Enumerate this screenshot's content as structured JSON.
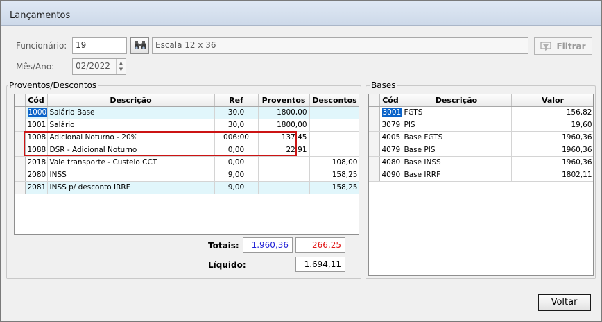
{
  "window": {
    "title": "Lançamentos"
  },
  "header": {
    "funcionario_label": "Funcionário:",
    "funcionario_value": "19",
    "escala_value": "Escala 12 x 36",
    "filtrar_label": "Filtrar",
    "mesano_label": "Mês/Ano:",
    "mesano_value": "02/2022"
  },
  "proventos": {
    "title": "Proventos/Descontos",
    "columns": [
      "Cód",
      "Descrição",
      "Ref",
      "Proventos",
      "Descontos"
    ],
    "rows": [
      {
        "cod": "1000",
        "desc": "Salário Base",
        "ref": "30,0",
        "prov": "1800,00",
        "desc_val": ""
      },
      {
        "cod": "1001",
        "desc": "Salário",
        "ref": "30,0",
        "prov": "1800,00",
        "desc_val": ""
      },
      {
        "cod": "1008",
        "desc": "Adicional Noturno - 20%",
        "ref": "006:00",
        "prov": "137,45",
        "desc_val": ""
      },
      {
        "cod": "1088",
        "desc": "DSR - Adicional Noturno",
        "ref": "0,00",
        "prov": "22,91",
        "desc_val": ""
      },
      {
        "cod": "2018",
        "desc": "Vale transporte - Custeio CCT",
        "ref": "0,00",
        "prov": "",
        "desc_val": "108,00"
      },
      {
        "cod": "2080",
        "desc": "INSS",
        "ref": "9,00",
        "prov": "",
        "desc_val": "158,25"
      },
      {
        "cod": "2081",
        "desc": "INSS p/ desconto IRRF",
        "ref": "9,00",
        "prov": "",
        "desc_val": "158,25"
      }
    ]
  },
  "totals": {
    "totais_label": "Totais:",
    "proventos_total": "1.960,36",
    "descontos_total": "266,25",
    "liquido_label": "Líquido:",
    "liquido_value": "1.694,11"
  },
  "bases": {
    "title": "Bases",
    "columns": [
      "Cód",
      "Descrição",
      "Valor"
    ],
    "rows": [
      {
        "cod": "3001",
        "desc": "FGTS",
        "valor": "156,82"
      },
      {
        "cod": "3079",
        "desc": "PIS",
        "valor": "19,60"
      },
      {
        "cod": "4005",
        "desc": "Base FGTS",
        "valor": "1960,36"
      },
      {
        "cod": "4079",
        "desc": "Base PIS",
        "valor": "1960,36"
      },
      {
        "cod": "4080",
        "desc": "Base INSS",
        "valor": "1960,36"
      },
      {
        "cod": "4090",
        "desc": "Base IRRF",
        "valor": "1802,11"
      }
    ]
  },
  "footer": {
    "voltar_label": "Voltar"
  },
  "colors": {
    "highlight_row": "#e1f6fb",
    "selection": "#0a63c9",
    "proventos_total": "#1f1fd6",
    "descontos_total": "#e01414",
    "annotation_box": "#cc1414"
  },
  "icons": {
    "search": "binoculars-icon",
    "filter": "filter-icon"
  }
}
